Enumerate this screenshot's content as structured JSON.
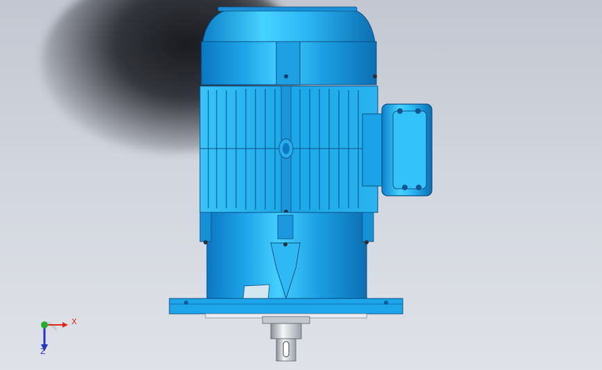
{
  "viewport": {
    "background_top": "#c2c7d1",
    "background_bottom": "#dfe2e8",
    "model": "electric-motor",
    "model_color": "#1ea4e6",
    "model_highlight": "#45d3ff",
    "model_dark": "#0c6fb3"
  },
  "triad": {
    "x_label": "X",
    "z_label": "Z",
    "x_color": "#e0261b",
    "y_color": "#1bb12a",
    "z_color": "#2433c8"
  }
}
